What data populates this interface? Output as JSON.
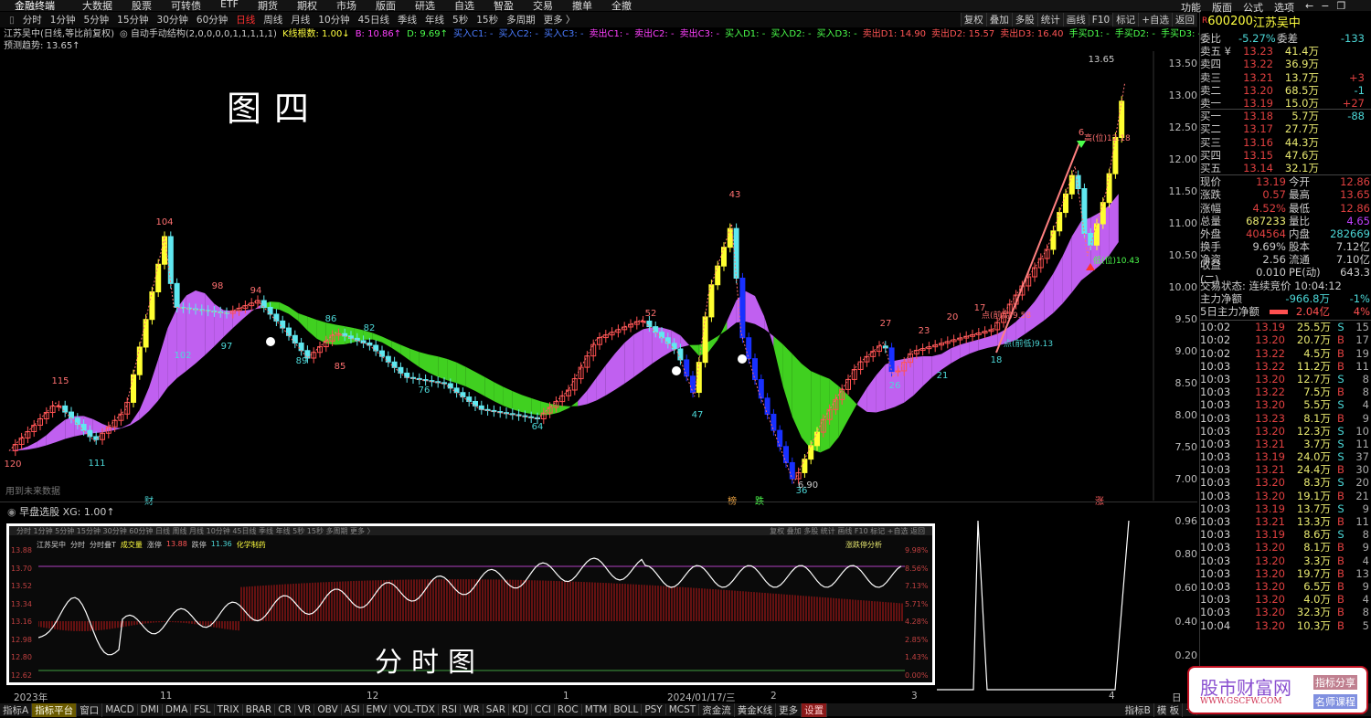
{
  "menu": {
    "logo": "金融终端",
    "items": [
      "大数据",
      "股票",
      "可转债",
      "ETF",
      "期货",
      "期权",
      "市场",
      "版面",
      "研选",
      "自选",
      "智盈",
      "交易",
      "撤单",
      "全撤"
    ],
    "right": [
      "功能",
      "版面",
      "公式",
      "选项"
    ]
  },
  "toolbar": {
    "periods": [
      "分时",
      "1分钟",
      "5分钟",
      "15分钟",
      "30分钟",
      "60分钟",
      "日线",
      "周线",
      "月线",
      "10分钟",
      "45日线",
      "季线",
      "年线",
      "5秒",
      "15秒",
      "多周期",
      "更多 〉"
    ],
    "active": "日线",
    "right": [
      "复权",
      "叠加",
      "多股",
      "统计",
      "画线",
      "F10",
      "标记",
      "+自选",
      "返回"
    ]
  },
  "indicator_line": [
    {
      "t": "江苏吴中(日线,等比前复权)",
      "c": "c-w"
    },
    {
      "t": "◎ 自动手动结构(2,0,0,0,0,1,1,1,1,1)",
      "c": "c-w"
    },
    {
      "t": "K线根数: 1.00↓",
      "c": "c-y"
    },
    {
      "t": "B: 10.86↑",
      "c": "c-m"
    },
    {
      "t": "D: 9.69↑",
      "c": "c-g"
    },
    {
      "t": "买入C1: -",
      "c": "c-b"
    },
    {
      "t": "买入C2: -",
      "c": "c-b"
    },
    {
      "t": "买入C3: -",
      "c": "c-b"
    },
    {
      "t": "卖出C1: -",
      "c": "c-m"
    },
    {
      "t": "卖出C2: -",
      "c": "c-m"
    },
    {
      "t": "卖出C3: -",
      "c": "c-m"
    },
    {
      "t": "买入D1: -",
      "c": "c-g"
    },
    {
      "t": "买入D2: -",
      "c": "c-g"
    },
    {
      "t": "买入D3: -",
      "c": "c-g"
    },
    {
      "t": "卖出D1: 14.90",
      "c": "c-r"
    },
    {
      "t": "卖出D2: 15.57",
      "c": "c-r"
    },
    {
      "t": "卖出D3: 16.40",
      "c": "c-r"
    },
    {
      "t": "手买D1: -",
      "c": "c-g"
    },
    {
      "t": "手买D2: -",
      "c": "c-g"
    },
    {
      "t": "手买D3: -",
      "c": "c-g"
    },
    {
      "t": "手卖D1: -",
      "c": "c-r"
    },
    {
      "t": "手卖D2: -",
      "c": "c-r"
    },
    {
      "t": "手卖D3: -",
      "c": "c-r"
    },
    {
      "t": "预测趋势: 13.65↑",
      "c": "c-w"
    }
  ],
  "figure_label": "图四",
  "chart": {
    "y_ticks": [
      "13.50",
      "13.00",
      "12.50",
      "12.00",
      "11.50",
      "11.00",
      "10.50",
      "10.00",
      "9.50",
      "9.00",
      "8.50",
      "8.00",
      "7.50",
      "7.00"
    ],
    "price_path": [
      [
        0,
        7.45
      ],
      [
        30,
        8.2
      ],
      [
        55,
        7.6
      ],
      [
        75,
        8.1
      ],
      [
        100,
        10.8
      ],
      [
        106,
        9.7
      ],
      [
        140,
        9.6
      ],
      [
        160,
        9.8
      ],
      [
        175,
        9.4
      ],
      [
        192,
        8.9
      ],
      [
        210,
        9.3
      ],
      [
        232,
        9.1
      ],
      [
        255,
        8.6
      ],
      [
        280,
        8.5
      ],
      [
        303,
        8.1
      ],
      [
        340,
        7.95
      ],
      [
        360,
        8.4
      ],
      [
        378,
        9.2
      ],
      [
        407,
        9.5
      ],
      [
        430,
        9.0
      ],
      [
        441,
        8.3
      ],
      [
        450,
        9.9
      ],
      [
        465,
        11.0
      ],
      [
        471,
        9.3
      ],
      [
        482,
        8.4
      ],
      [
        505,
        6.95
      ],
      [
        523,
        7.9
      ],
      [
        546,
        8.8
      ],
      [
        563,
        9.15
      ],
      [
        569,
        8.6
      ],
      [
        581,
        9.0
      ],
      [
        610,
        9.2
      ],
      [
        633,
        9.35
      ],
      [
        668,
        10.6
      ],
      [
        686,
        11.9
      ],
      [
        694,
        10.5
      ],
      [
        706,
        11.5
      ],
      [
        718,
        13.2
      ]
    ],
    "labels": [
      "120",
      "115",
      "111",
      "104",
      "102",
      "98",
      "97",
      "94",
      "89",
      "86",
      "85",
      "82",
      "76",
      "64",
      "52",
      "47",
      "43",
      "36",
      "27",
      "26",
      "23",
      "20",
      "21",
      "17",
      "18",
      "6",
      "13.65",
      "6.90"
    ],
    "annotations": [
      "点(前高)9.58",
      "点(前低)9.13",
      "高(位)12.18",
      "低(位)10.43"
    ],
    "future_note": "用到未来数据",
    "markers": [
      "财",
      "榜",
      "跌",
      "涨"
    ]
  },
  "lower": {
    "title": "早盘选股",
    "xg": "XG: 1.00↑",
    "y_ticks": [
      "0.96",
      "0.80",
      "0.60",
      "0.40",
      "0.20"
    ]
  },
  "intraday": {
    "periods": "分时 1分钟 5分钟 15分钟 30分钟 60分钟 日线 周线 月线 10分钟 45日线 季线 年线 5秒 15秒 多周期 更多 〉",
    "tools": "复权 叠加 多股 统计 画线 F10 标记 +自选 返回",
    "header": [
      {
        "t": "江苏吴中",
        "c": "c-w"
      },
      {
        "t": "分时",
        "c": "c-w"
      },
      {
        "t": "分时叠T",
        "c": "c-w"
      },
      {
        "t": "成交量",
        "c": "c-y"
      },
      {
        "t": "涨停",
        "c": "c-w"
      },
      {
        "t": "13.88",
        "c": "c-r"
      },
      {
        "t": "跌停",
        "c": "c-w"
      },
      {
        "t": "11.36",
        "c": "c-c"
      },
      {
        "t": "化学制药",
        "c": "c-y"
      }
    ],
    "analysis": "涨跌停分析",
    "y_left": [
      "13.88",
      "13.70",
      "13.52",
      "13.34",
      "13.16",
      "12.98",
      "12.80",
      "12.62"
    ],
    "y_right": [
      "9.98%",
      "8.56%",
      "7.13%",
      "5.71%",
      "4.28%",
      "2.85%",
      "1.43%",
      "0.00%"
    ],
    "caption": "分时图"
  },
  "x_axis": [
    {
      "t": "2023年"
    },
    {
      "t": "11"
    },
    {
      "t": "12"
    },
    {
      "t": "1"
    },
    {
      "t": "2024/01/17/三"
    },
    {
      "t": "2"
    },
    {
      "t": "3"
    },
    {
      "t": "4"
    },
    {
      "t": "日线"
    }
  ],
  "bottom_tabs": [
    "指标A",
    "指标平台",
    "窗口",
    "MACD",
    "DMI",
    "DMA",
    "FSL",
    "TRIX",
    "BRAR",
    "CR",
    "VR",
    "OBV",
    "ASI",
    "EMV",
    "VOL-TDX",
    "RSI",
    "WR",
    "SAR",
    "KDJ",
    "CCI",
    "ROC",
    "MTM",
    "BOLL",
    "PSY",
    "MCST",
    "资金流",
    "黄金K线",
    "更多",
    "设置"
  ],
  "bottom_right": [
    "指标B",
    "模 板",
    "+"
  ],
  "stock": {
    "code": "600200",
    "name": "江苏吴中",
    "prefix": "R"
  },
  "quote": {
    "weibi_label": "委比",
    "weibi": "-5.27%",
    "weicha_label": "委差",
    "weicha": "-133",
    "book": [
      [
        "卖五 ¥",
        "13.23",
        "41.4万",
        ""
      ],
      [
        "卖四",
        "13.22",
        "36.9万",
        ""
      ],
      [
        "卖三",
        "13.21",
        "13.7万",
        "+3"
      ],
      [
        "卖二",
        "13.20",
        "68.5万",
        "-1"
      ],
      [
        "卖一",
        "13.19",
        "15.0万",
        "+27"
      ],
      [
        "买一",
        "13.18",
        "5.7万",
        "-88"
      ],
      [
        "买二",
        "13.17",
        "27.7万",
        ""
      ],
      [
        "买三",
        "13.16",
        "44.3万",
        ""
      ],
      [
        "买四",
        "13.15",
        "47.6万",
        ""
      ],
      [
        "买五",
        "13.14",
        "32.1万",
        ""
      ]
    ],
    "stats": [
      [
        "现价",
        "13.19",
        "今开",
        "12.86"
      ],
      [
        "涨跌",
        "0.57",
        "最高",
        "13.65"
      ],
      [
        "涨幅",
        "4.52%",
        "最低",
        "12.86"
      ],
      [
        "总量",
        "687233",
        "量比",
        "4.65"
      ],
      [
        "外盘",
        "404564",
        "内盘",
        "282669"
      ],
      [
        "换手",
        "9.69%",
        "股本",
        "7.12亿"
      ],
      [
        "净资",
        "2.56",
        "流通",
        "7.10亿"
      ],
      [
        "收益(二)",
        "0.010",
        "PE(动)",
        "643.3"
      ]
    ],
    "status": "交易状态: 连续竞价 10:04:12",
    "main_net_label": "主力净额",
    "main_net": "-966.8万",
    "main_net_pct": "-1%",
    "net5_label": "5日主力净额",
    "net5": "2.04亿",
    "net5_pct": "4%"
  },
  "trades": [
    [
      "10:02",
      "13.19",
      "25.5万",
      "S",
      "15"
    ],
    [
      "10:02",
      "13.20",
      "20.7万",
      "B",
      "17"
    ],
    [
      "10:02",
      "13.22",
      "4.5万",
      "B",
      "19"
    ],
    [
      "10:03",
      "13.22",
      "11.2万",
      "B",
      "11"
    ],
    [
      "10:03",
      "13.20",
      "12.7万",
      "S",
      "8"
    ],
    [
      "10:03",
      "13.22",
      "7.5万",
      "B",
      "8"
    ],
    [
      "10:03",
      "13.20",
      "5.5万",
      "S",
      "4"
    ],
    [
      "10:03",
      "13.23",
      "8.1万",
      "B",
      "9"
    ],
    [
      "10:03",
      "13.20",
      "12.3万",
      "S",
      "10"
    ],
    [
      "10:03",
      "13.21",
      "3.7万",
      "S",
      "11"
    ],
    [
      "10:03",
      "13.19",
      "24.0万",
      "S",
      "37"
    ],
    [
      "10:03",
      "13.21",
      "24.4万",
      "B",
      "30"
    ],
    [
      "10:03",
      "13.20",
      "8.3万",
      "S",
      "20"
    ],
    [
      "10:03",
      "13.20",
      "19.1万",
      "B",
      "21"
    ],
    [
      "10:03",
      "13.19",
      "13.7万",
      "S",
      "9"
    ],
    [
      "10:03",
      "13.21",
      "13.3万",
      "B",
      "11"
    ],
    [
      "10:03",
      "13.19",
      "8.6万",
      "S",
      "8"
    ],
    [
      "10:03",
      "13.20",
      "8.1万",
      "B",
      "9"
    ],
    [
      "10:03",
      "13.20",
      "3.3万",
      "B",
      "4"
    ],
    [
      "10:03",
      "13.20",
      "19.7万",
      "B",
      "13"
    ],
    [
      "10:03",
      "13.20",
      "6.5万",
      "B",
      "9"
    ],
    [
      "10:03",
      "13.20",
      "4.0万",
      "B",
      "4"
    ],
    [
      "10:03",
      "13.20",
      "32.3万",
      "B",
      "8"
    ],
    [
      "10:04",
      "13.20",
      "10.3万",
      "B",
      "5"
    ]
  ],
  "watermark": {
    "name": "股市财富网",
    "url": "WWW.GSCFW.COM",
    "tag1": "指标分享",
    "tag2": "名师课程"
  },
  "colors": {
    "up": "#ff4040",
    "down": "#3050ff",
    "purple_band": "#c060f0",
    "green_band": "#40d020"
  }
}
